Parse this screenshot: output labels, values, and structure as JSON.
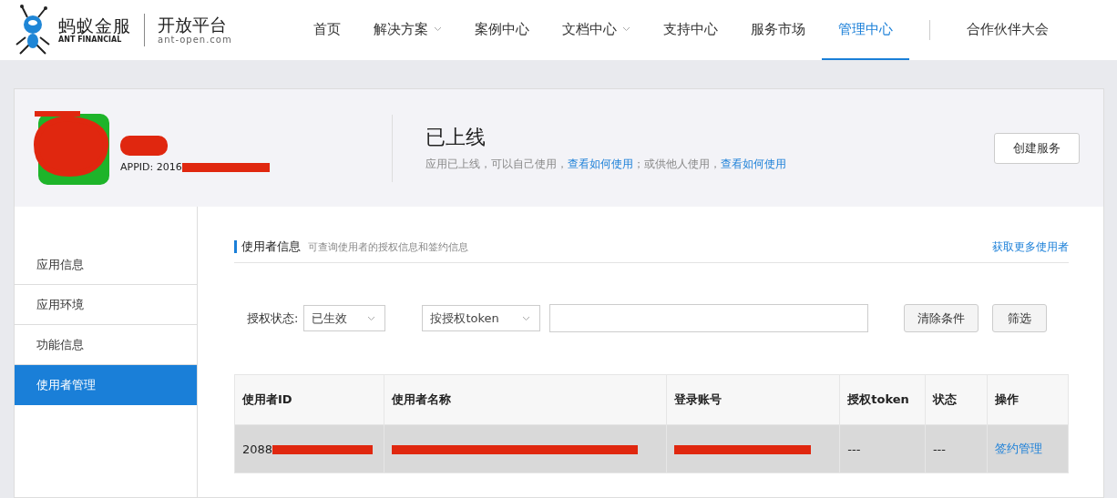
{
  "header": {
    "brand_cn": "蚂蚁金服",
    "brand_en": "ANT FINANCIAL",
    "platform": "开放平台",
    "domain": "ant-open.com",
    "nav": [
      {
        "label": "首页",
        "selected": false,
        "dropdown": false
      },
      {
        "label": "解决方案",
        "selected": false,
        "dropdown": true
      },
      {
        "label": "案例中心",
        "selected": false,
        "dropdown": false
      },
      {
        "label": "文档中心",
        "selected": false,
        "dropdown": true
      },
      {
        "label": "支持中心",
        "selected": false,
        "dropdown": false
      },
      {
        "label": "服务市场",
        "selected": false,
        "dropdown": false
      },
      {
        "label": "管理中心",
        "selected": true,
        "dropdown": false
      }
    ],
    "extra_link": "合作伙伴大会"
  },
  "app": {
    "appid": "APPID: 2016",
    "status": "已上线",
    "desc_parts": [
      {
        "kind": "text",
        "text": "应用已上线，可以自己使用，"
      },
      {
        "kind": "link",
        "text": "查看如何使用"
      },
      {
        "kind": "text",
        "text": "；或供他人使用，"
      },
      {
        "kind": "link",
        "text": "查看如何使用"
      }
    ],
    "create_button": "创建服务"
  },
  "sidebar": {
    "items": [
      {
        "label": "应用信息",
        "selected": false
      },
      {
        "label": "应用环境",
        "selected": false
      },
      {
        "label": "功能信息",
        "selected": false
      },
      {
        "label": "使用者管理",
        "selected": true
      }
    ]
  },
  "section": {
    "title": "使用者信息",
    "subtitle": "可查询使用者的授权信息和签约信息",
    "more_link": "获取更多使用者"
  },
  "filters": {
    "status_label": "授权状态:",
    "status_value": "已生效",
    "type_value": "按授权token",
    "clear_button": "清除条件",
    "filter_button": "筛选"
  },
  "table": {
    "columns": [
      "使用者ID",
      "使用者名称",
      "登录账号",
      "授权token",
      "状态",
      "操作"
    ],
    "rows": [
      {
        "cells": [
          {
            "kind": "text",
            "text": "2088",
            "redacted": true
          },
          {
            "kind": "redacted"
          },
          {
            "kind": "redacted"
          },
          {
            "kind": "text",
            "text": "---",
            "redacted": false
          },
          {
            "kind": "text",
            "text": "---",
            "redacted": false
          },
          {
            "kind": "link",
            "text": "签约管理",
            "redacted": false
          }
        ]
      }
    ]
  }
}
